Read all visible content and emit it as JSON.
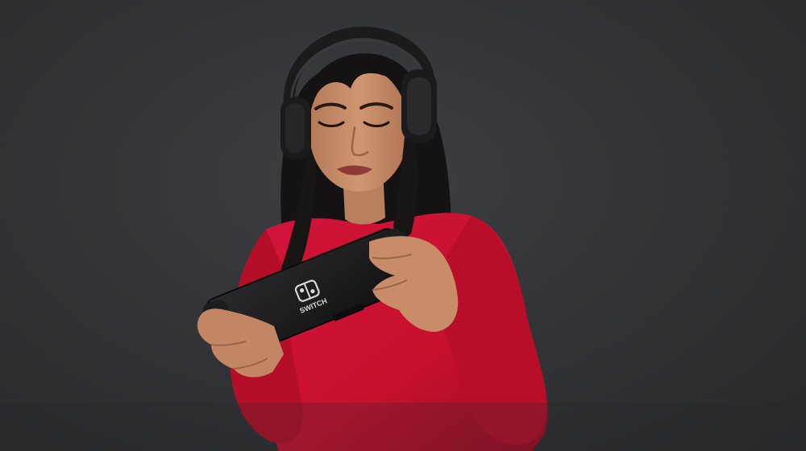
{
  "photo": {
    "subject": "woman-playing-handheld-console",
    "console": {
      "logo_wordmark": "SWITCH",
      "logo_icon": "nintendo-switch-logo-icon"
    },
    "colors": {
      "background": "#333437",
      "sweater": "#c8102e",
      "hair": "#141212",
      "skin": "#c48a66",
      "headphones": "#1b1b1c",
      "console": "#161617"
    }
  }
}
